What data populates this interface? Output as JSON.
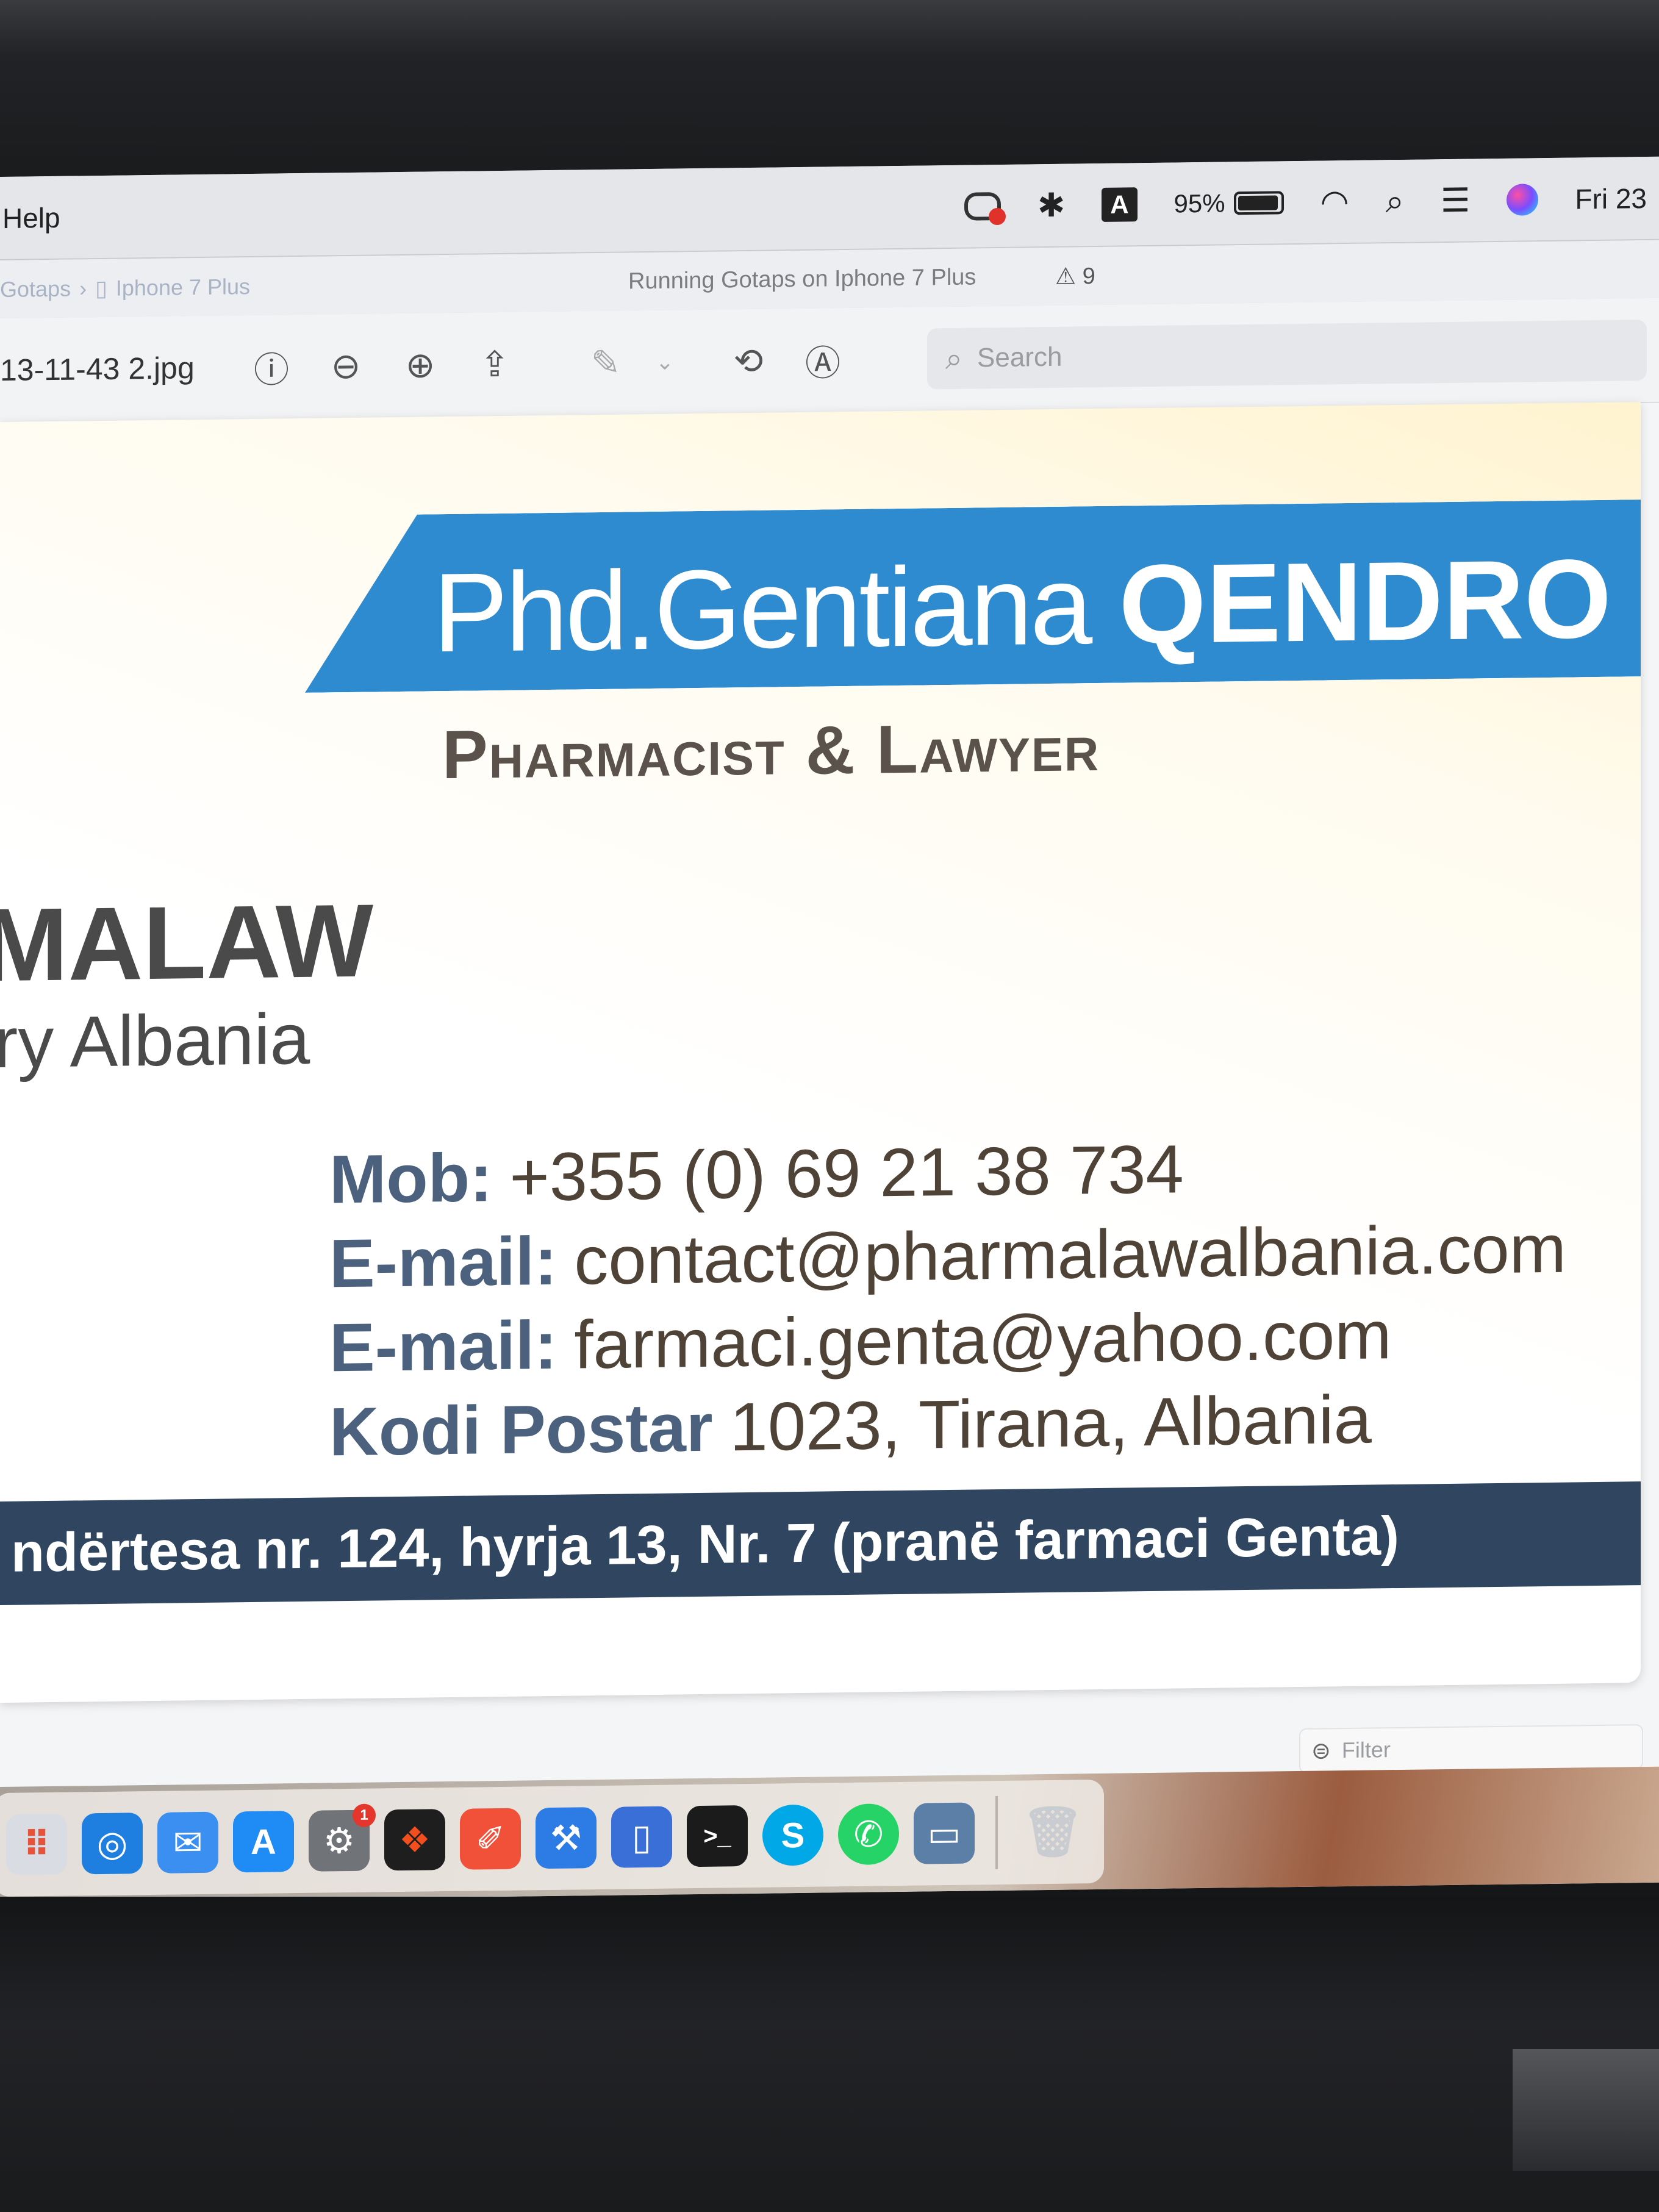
{
  "menubar": {
    "menu_label": "Help",
    "input_source": "A",
    "battery_percent": "95%",
    "battery_level": 0.95,
    "clock": "Fri 23"
  },
  "tabstrip": {
    "breadcrumb_project": "Gotaps",
    "breadcrumb_device": "Iphone 7 Plus",
    "run_status": "Running Gotaps on Iphone 7 Plus",
    "warning_count": "9"
  },
  "toolbar": {
    "filename": "13-11-43 2.jpg",
    "search_placeholder": "Search"
  },
  "card": {
    "name_light": "Phd.Gentiana ",
    "name_bold": "QENDRO",
    "role": "Pharmacist & Lawyer",
    "brand": "MALAW",
    "brand_sub": "ry Albania",
    "contact": [
      {
        "label": "Mob:",
        "value": "+355 (0) 69 21 38 734"
      },
      {
        "label": "E-mail:",
        "value": "contact@pharmalawalbania.com"
      },
      {
        "label": "E-mail:",
        "value": "farmaci.genta@yahoo.com"
      },
      {
        "label": "Kodi Postar",
        "value": "1023, Tirana, Albania"
      }
    ],
    "address": "ndërtesa nr. 124, hyrja 13, Nr. 7 (pranë farmaci Genta)"
  },
  "filter": {
    "placeholder": "Filter"
  },
  "dock": {
    "settings_badge": "1",
    "apps": [
      "launchpad",
      "safari",
      "mail",
      "app-store",
      "system-preferences",
      "figma",
      "toolbox",
      "xcode",
      "simulator",
      "terminal",
      "skype",
      "whatsapp",
      "preview",
      "trash"
    ]
  },
  "colors": {
    "name_band": "#2e8bd0",
    "address_band": "#2f4560",
    "label_blue": "#4b617e",
    "value_brown": "#4e4336"
  }
}
